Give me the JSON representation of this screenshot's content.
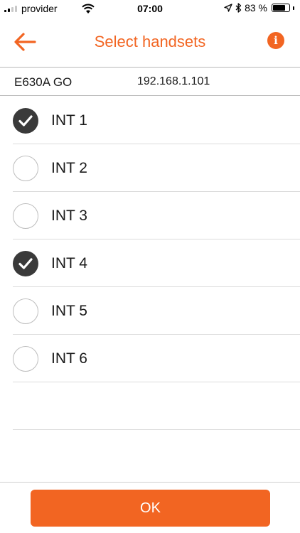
{
  "status_bar": {
    "carrier": "provider",
    "time": "07:00",
    "battery_text": "83 %",
    "battery_level": 0.83,
    "icons": [
      "signal-icon",
      "wifi-icon",
      "location-arrow-icon",
      "bluetooth-icon",
      "battery-icon"
    ]
  },
  "header": {
    "title": "Select handsets",
    "back_icon": "arrow-left-icon",
    "info_icon": "info-icon",
    "info_glyph": "i"
  },
  "device": {
    "name": "E630A GO",
    "ip": "192.168.1.101"
  },
  "handsets": [
    {
      "label": "INT 1",
      "selected": true
    },
    {
      "label": "INT 2",
      "selected": false
    },
    {
      "label": "INT 3",
      "selected": false
    },
    {
      "label": "INT 4",
      "selected": true
    },
    {
      "label": "INT 5",
      "selected": false
    },
    {
      "label": "INT 6",
      "selected": false
    }
  ],
  "footer": {
    "ok_label": "OK"
  },
  "colors": {
    "accent": "#f26522",
    "checked": "#3a3a3a",
    "unchecked_border": "#bdbdbd"
  }
}
